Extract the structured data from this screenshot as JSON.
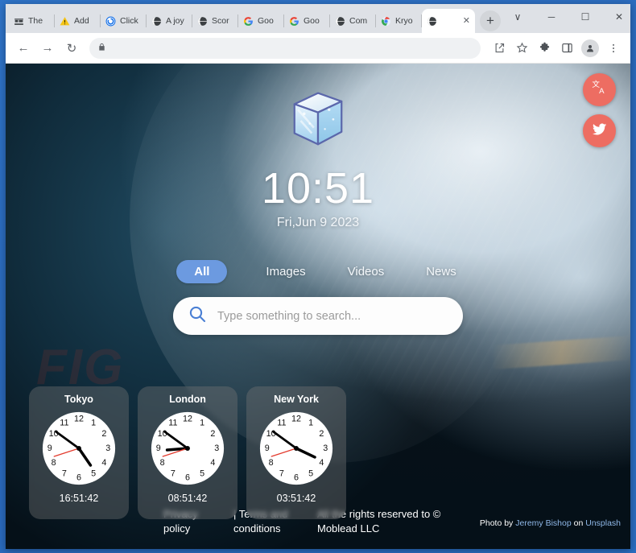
{
  "window": {
    "controls": [
      {
        "name": "tab-search",
        "glyph": "∨"
      },
      {
        "name": "minimize",
        "glyph": "─"
      },
      {
        "name": "maximize",
        "glyph": "☐"
      },
      {
        "name": "close",
        "glyph": "✕"
      }
    ]
  },
  "tabs": [
    {
      "label": "The ",
      "favicon": "bed-icon"
    },
    {
      "label": "Add",
      "favicon": "warning-icon"
    },
    {
      "label": "Click",
      "favicon": "chrome-blue-icon"
    },
    {
      "label": "A joy",
      "favicon": "globe-icon"
    },
    {
      "label": "Scor",
      "favicon": "globe-icon"
    },
    {
      "label": "Goo",
      "favicon": "google-icon"
    },
    {
      "label": "Goo",
      "favicon": "google-icon"
    },
    {
      "label": "Com",
      "favicon": "globe-icon"
    },
    {
      "label": "Kryo",
      "favicon": "chrome-color-icon"
    },
    {
      "label": " ",
      "favicon": "globe-icon",
      "active": true,
      "close": "✕"
    }
  ],
  "newtab": {
    "label": "+"
  },
  "toolbar": {
    "back": "←",
    "forward": "→",
    "reload": "↻",
    "lock_icon": "lock-icon",
    "url": "",
    "url_placeholder": "",
    "icons": [
      {
        "name": "share-icon"
      },
      {
        "name": "bookmark-star-icon"
      },
      {
        "name": "extensions-puzzle-icon"
      },
      {
        "name": "side-panel-icon"
      },
      {
        "name": "profile-avatar-icon"
      },
      {
        "name": "more-menu-icon"
      }
    ]
  },
  "page": {
    "watermark": "FIG",
    "logo": "ice-cube-logo",
    "time": "10:51",
    "date": "Fri,Jun 9 2023",
    "float_buttons": [
      {
        "name": "translate-button",
        "icon": "translate-icon"
      },
      {
        "name": "twitter-button",
        "icon": "twitter-bird-icon"
      }
    ],
    "accent_color": "#6c9ae0",
    "float_button_color": "#ed6d62",
    "search_tabs": [
      {
        "label": "All",
        "active": true
      },
      {
        "label": "Images",
        "active": false
      },
      {
        "label": "Videos",
        "active": false
      },
      {
        "label": "News",
        "active": false
      }
    ],
    "search": {
      "icon": "search-magnifier-icon",
      "value": "",
      "placeholder": "Type something to search..."
    },
    "clocks": [
      {
        "city": "Tokyo",
        "digital": "16:51:42",
        "hour_deg": 505.5,
        "minute_deg": 306,
        "second_deg": 252
      },
      {
        "city": "London",
        "digital": "08:51:42",
        "hour_deg": 265.5,
        "minute_deg": 306,
        "second_deg": 252
      },
      {
        "city": "New York",
        "digital": "03:51:42",
        "hour_deg": 115.5,
        "minute_deg": 306,
        "second_deg": 252
      }
    ],
    "clock_numerals": [
      "12",
      "1",
      "2",
      "3",
      "4",
      "5",
      "6",
      "7",
      "8",
      "9",
      "10",
      "11"
    ],
    "footer": {
      "privacy": "Privacy policy",
      "separator": "| Terms and conditions",
      "copyright": "All the rights reserved to © Moblead LLC",
      "credit_prefix": "Photo by",
      "credit_author": "Jeremy Bishop",
      "credit_mid": "on",
      "credit_source": "Unsplash"
    }
  }
}
